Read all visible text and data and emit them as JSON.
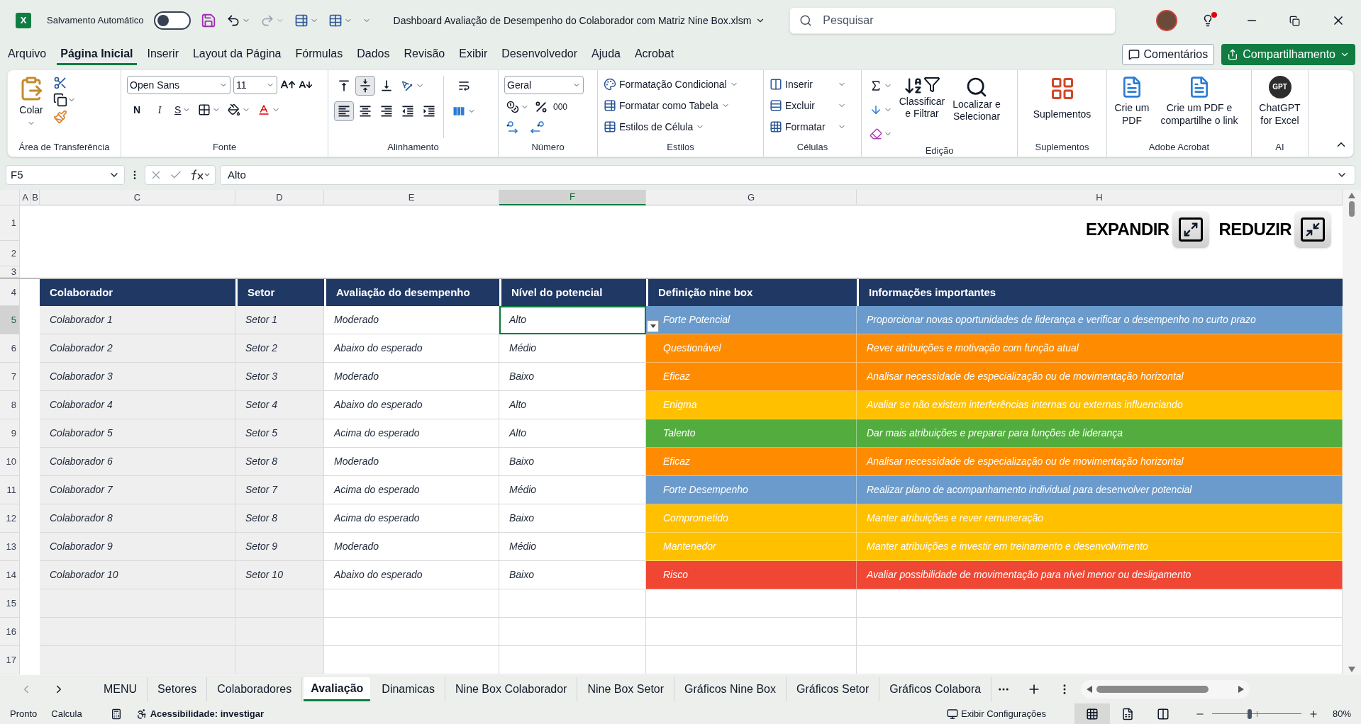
{
  "title_bar": {
    "app_logo": "X",
    "autosave_label": "Salvamento Automático",
    "autosave_on": false,
    "document_title": "Dashboard Avaliação de Desempenho do Colaborador com Matriz Nine Box.xlsm",
    "search_placeholder": "Pesquisar"
  },
  "menu_tabs": [
    {
      "label": "Arquivo",
      "selected": false
    },
    {
      "label": "Página Inicial",
      "selected": true
    },
    {
      "label": "Inserir",
      "selected": false
    },
    {
      "label": "Layout da Página",
      "selected": false
    },
    {
      "label": "Fórmulas",
      "selected": false
    },
    {
      "label": "Dados",
      "selected": false
    },
    {
      "label": "Revisão",
      "selected": false
    },
    {
      "label": "Exibir",
      "selected": false
    },
    {
      "label": "Desenvolvedor",
      "selected": false
    },
    {
      "label": "Ajuda",
      "selected": false
    },
    {
      "label": "Acrobat",
      "selected": false
    }
  ],
  "actions": {
    "comments": "Comentários",
    "share": "Compartilhamento"
  },
  "ribbon": {
    "clipboard": {
      "paste": "Colar",
      "label": "Área de Transferência"
    },
    "font": {
      "family": "Open Sans",
      "size": "11",
      "bold": "N",
      "italic": "I",
      "underline": "S",
      "label": "Fonte"
    },
    "alignment": {
      "vertical": [
        {
          "kind": "top",
          "selected": false
        },
        {
          "kind": "middle",
          "selected": true
        },
        {
          "kind": "bottom",
          "selected": false
        }
      ],
      "horizontal": [
        {
          "kind": "left",
          "selected": true
        },
        {
          "kind": "center",
          "selected": false
        },
        {
          "kind": "right",
          "selected": false
        }
      ],
      "label": "Alinhamento"
    },
    "number": {
      "format": "Geral",
      "thousands": "000",
      "label": "Número"
    },
    "styles": {
      "items": [
        "Formatação Condicional",
        "Formatar como Tabela",
        "Estilos de Célula"
      ],
      "label": "Estilos"
    },
    "cells": {
      "items": [
        "Inserir",
        "Excluir",
        "Formatar"
      ],
      "label": "Células"
    },
    "editing": {
      "sort": "Classificar e Filtrar",
      "find": "Localizar e Selecionar",
      "label": "Edição"
    },
    "addins": {
      "button": "Suplementos",
      "label": "Suplementos"
    },
    "acrobat": {
      "create": "Crie um PDF",
      "share": "Crie um PDF e compartilhe o link",
      "label": "Adobe Acrobat"
    },
    "ai": {
      "logo": "GPT",
      "button": "ChatGPT for Excel",
      "label": "AI"
    }
  },
  "formula_bar": {
    "name_box": "F5",
    "formula": "Alto"
  },
  "columns": [
    {
      "label": "A",
      "selected": false
    },
    {
      "label": "B",
      "selected": false
    },
    {
      "label": "C",
      "selected": false
    },
    {
      "label": "D",
      "selected": false
    },
    {
      "label": "E",
      "selected": false
    },
    {
      "label": "F",
      "selected": true
    },
    {
      "label": "G",
      "selected": false
    },
    {
      "label": "H",
      "selected": false
    }
  ],
  "sheet": {
    "top_rows": [
      "1",
      "2",
      "3"
    ],
    "buttons": [
      {
        "kind": "expand",
        "label": "EXPANDIR"
      },
      {
        "kind": "collapse",
        "label": "REDUZIR"
      }
    ],
    "header_row": "4",
    "headers": [
      "Colaborador",
      "Setor",
      "Avaliação do desempenho",
      "Nível do potencial",
      "Definição nine box",
      "Informações importantes"
    ],
    "rows": [
      {
        "number": "5",
        "collaborator": "Colaborador 1",
        "sector": "Setor 1",
        "performance": "Moderado",
        "potential": "Alto",
        "definition": "Forte Potencial",
        "info": "Proporcionar novas oportunidades de liderança e verificar o desempenho no curto prazo",
        "color": "#6a9bcc",
        "selected": true
      },
      {
        "number": "6",
        "collaborator": "Colaborador 2",
        "sector": "Setor 2",
        "performance": "Abaixo do esperado",
        "potential": "Médio",
        "definition": "Questionável",
        "info": "Rever atribuições e motivação com função atual",
        "color": "#ff8c00",
        "selected": false
      },
      {
        "number": "7",
        "collaborator": "Colaborador 3",
        "sector": "Setor 3",
        "performance": "Moderado",
        "potential": "Baixo",
        "definition": "Eficaz",
        "info": "Analisar necessidade de especialização ou de movimentação horizontal",
        "color": "#ff8c00",
        "selected": false
      },
      {
        "number": "8",
        "collaborator": "Colaborador 4",
        "sector": "Setor 4",
        "performance": "Abaixo do esperado",
        "potential": "Alto",
        "definition": "Enigma",
        "info": "Avaliar se não existem interferências internas ou externas influenciando",
        "color": "#ffc000",
        "selected": false
      },
      {
        "number": "9",
        "collaborator": "Colaborador 5",
        "sector": "Setor 5",
        "performance": "Acima do esperado",
        "potential": "Alto",
        "definition": "Talento",
        "info": "Dar mais atribuições e preparar para funções de liderança",
        "color": "#52ad3e",
        "selected": false
      },
      {
        "number": "10",
        "collaborator": "Colaborador 6",
        "sector": "Setor 8",
        "performance": "Moderado",
        "potential": "Baixo",
        "definition": "Eficaz",
        "info": "Analisar necessidade de especialização ou de movimentação horizontal",
        "color": "#ff8c00",
        "selected": false
      },
      {
        "number": "11",
        "collaborator": "Colaborador 7",
        "sector": "Setor 7",
        "performance": "Acima do esperado",
        "potential": "Médio",
        "definition": "Forte Desempenho",
        "info": "Realizar plano de acompanhamento individual para desenvolver potencial",
        "color": "#6a9bcc",
        "selected": false
      },
      {
        "number": "12",
        "collaborator": "Colaborador 8",
        "sector": "Setor 8",
        "performance": "Acima do esperado",
        "potential": "Baixo",
        "definition": "Comprometido",
        "info": "Manter atribuições e rever remuneração",
        "color": "#ffc000",
        "selected": false
      },
      {
        "number": "13",
        "collaborator": "Colaborador 9",
        "sector": "Setor 9",
        "performance": "Moderado",
        "potential": "Médio",
        "definition": "Mantenedor",
        "info": "Manter atribuições e investir em treinamento e desenvolvimento",
        "color": "#ffc000",
        "selected": false
      },
      {
        "number": "14",
        "collaborator": "Colaborador 10",
        "sector": "Setor 10",
        "performance": "Abaixo do esperado",
        "potential": "Baixo",
        "definition": "Risco",
        "info": "Avaliar possibilidade de movimentação para nível menor ou desligamento",
        "color": "#ef4733",
        "selected": false
      }
    ],
    "empty_rows": [
      "15",
      "16",
      "17"
    ]
  },
  "sheet_tabs": [
    {
      "label": "MENU",
      "selected": false
    },
    {
      "label": "Setores",
      "selected": false
    },
    {
      "label": "Colaboradores",
      "selected": false
    },
    {
      "label": "Avaliação",
      "selected": true
    },
    {
      "label": "Dinamicas",
      "selected": false
    },
    {
      "label": "Nine Box Colaborador",
      "selected": false
    },
    {
      "label": "Nine Box Setor",
      "selected": false
    },
    {
      "label": "Gráficos Nine Box",
      "selected": false
    },
    {
      "label": "Gráficos Setor",
      "selected": false
    },
    {
      "label": "Gráficos Colabora",
      "selected": false
    }
  ],
  "status_bar": {
    "ready": "Pronto",
    "calc": "Calcula",
    "accessibility": "Acessibilidade: investigar",
    "display_settings": "Exibir Configurações",
    "views": [
      {
        "kind": "normal",
        "selected": true
      },
      {
        "kind": "page_layout",
        "selected": false
      },
      {
        "kind": "page_break",
        "selected": false
      }
    ],
    "zoom_slider": {
      "level": 0.42
    },
    "zoom": "80%"
  }
}
